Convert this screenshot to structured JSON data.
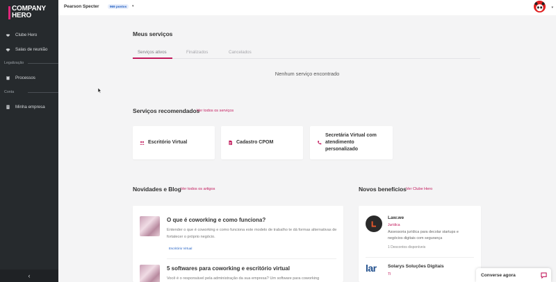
{
  "brand": {
    "line1": "COMPANY",
    "line2": "HERO",
    "accent": "#e0267a"
  },
  "sidebar": {
    "items": [
      {
        "label": "Clube Hero",
        "icon": "handshake-icon"
      },
      {
        "label": "Salas de reunião",
        "icon": "meeting-room-icon"
      }
    ],
    "sections": [
      {
        "label": "Legalização",
        "items": [
          {
            "label": "Processos",
            "icon": "clipboard-icon"
          }
        ]
      },
      {
        "label": "Conta",
        "items": [
          {
            "label": "Minha empresa",
            "icon": "building-icon"
          }
        ]
      }
    ],
    "collapse_icon": "‹"
  },
  "topbar": {
    "user_name": "Pearson Specter",
    "points": "969 pontos",
    "caret": "▾"
  },
  "services": {
    "title": "Meus serviços",
    "tabs": [
      "Serviços ativos",
      "Finalizados",
      "Cancelados"
    ],
    "active_tab": "Serviços ativos",
    "empty_message": "Nenhum serviço encontrado"
  },
  "recommended": {
    "title": "Serviços recomendados",
    "link": "Ver todos os serviços",
    "cards": [
      {
        "title": "Escritório Virtual",
        "icon": "people-icon"
      },
      {
        "title": "Cadastro CPOM",
        "icon": "document-icon"
      },
      {
        "title": "Secretária Virtual com atendimento personalizado",
        "icon": "phone-icon"
      }
    ]
  },
  "blog": {
    "title": "Novidades e Blog",
    "link": "Ver todos os artigos",
    "posts": [
      {
        "title": "O que é coworking e como funciona?",
        "desc": "Entender o que é coworking e como funciona este modelo de trabalho te dá formas alternativas de fortalecer o próprio negócio.",
        "tag": "Escritório Virtual"
      },
      {
        "title": "5 softwares para coworking e escritório virtual",
        "desc": "Você é o responsável pela administração da sua empresa? Um software para coworking"
      }
    ]
  },
  "benefits": {
    "title": "Novos benefícios",
    "link": "Ver Clube Hero",
    "items": [
      {
        "name": "Law.we",
        "category": "Jurídica",
        "desc": "Assessoria jurídica para decolar startups e negócios digitais com segurança",
        "discounts": "1 Descontos disponíveis"
      },
      {
        "name": "Solarys Soluções Digitais",
        "category": "TI",
        "logo_text": "lar"
      }
    ]
  },
  "chat": {
    "label": "Converse agora",
    "icon": "chat-bubble-icon"
  },
  "colors": {
    "accent": "#c2185b",
    "sidebar": "#262a2d",
    "link_blue": "#1f5ec2"
  }
}
